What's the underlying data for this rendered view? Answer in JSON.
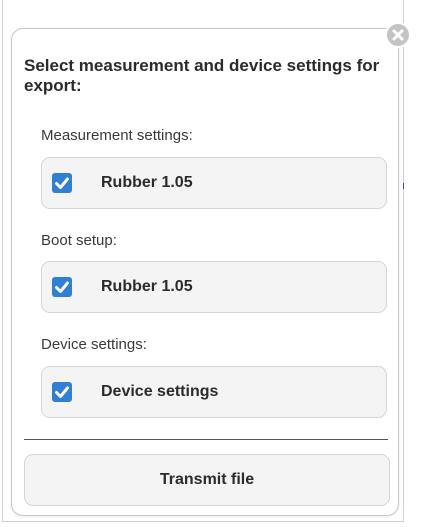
{
  "dialog": {
    "title": "Select measurement and device settings for export:",
    "sections": [
      {
        "label": "Measurement settings:",
        "option": {
          "label": "Rubber 1.05",
          "checked": true
        }
      },
      {
        "label": "Boot setup:",
        "option": {
          "label": "Rubber 1.05",
          "checked": true
        }
      },
      {
        "label": "Device settings:",
        "option": {
          "label": "Device settings",
          "checked": true
        }
      }
    ],
    "transmit_label": "Transmit file",
    "close_icon": "close-icon"
  },
  "colors": {
    "checkbox": "#2f7fd6",
    "close_button": "#c4c4c4",
    "option_background": "#f4f4f4"
  }
}
